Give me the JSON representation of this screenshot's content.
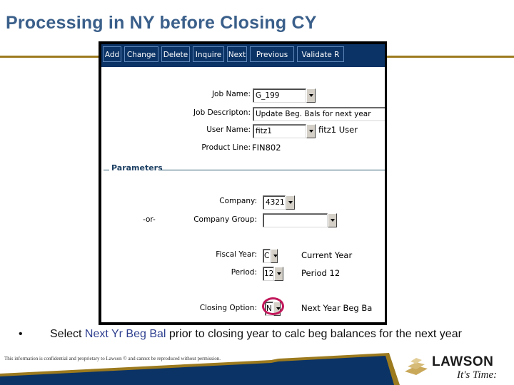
{
  "slide": {
    "title": "Processing in NY before Closing CY",
    "bullet_symbol": "•",
    "bullet_prefix": "Select ",
    "bullet_highlight": "Next Yr Beg Bal",
    "bullet_suffix": " prior to closing year to calc beg balances for the next year",
    "confidential": "This information is confidential and proprietary to Lawson © and cannot be reproduced without permission.",
    "logo_word": "LAWSON",
    "logo_tagline": "It's Time:",
    "colors": {
      "title": "#3a5f8a",
      "gold": "#9c7a1e",
      "navy": "#0b3366",
      "highlight": "#c2185b",
      "bullet_highlight": "#2e3f8f"
    }
  },
  "toolbar": {
    "buttons": [
      "Add",
      "Change",
      "Delete",
      "Inquire",
      "Next",
      "Previous",
      "Validate R"
    ]
  },
  "form": {
    "job_name_label": "Job Name:",
    "job_name_value": "G_199",
    "job_description_label": "Job Descripton:",
    "job_description_value": "Update Beg. Bals for next year",
    "user_name_label": "User Name:",
    "user_name_value": "fitz1",
    "user_name_desc": "fitz1 User",
    "product_line_label": "Product Line:",
    "product_line_value": "FIN802",
    "parameters_heading": "Parameters",
    "company_label": "Company:",
    "company_value": "4321",
    "or_label": "-or-",
    "company_group_label": "Company Group:",
    "company_group_value": "",
    "fiscal_year_label": "Fiscal Year:",
    "fiscal_year_value": "C",
    "fiscal_year_desc": "Current Year",
    "period_label": "Period:",
    "period_value": "12",
    "period_desc": "Period 12",
    "closing_option_label": "Closing Option:",
    "closing_option_value": "N",
    "closing_option_desc": "Next Year Beg Ba"
  }
}
